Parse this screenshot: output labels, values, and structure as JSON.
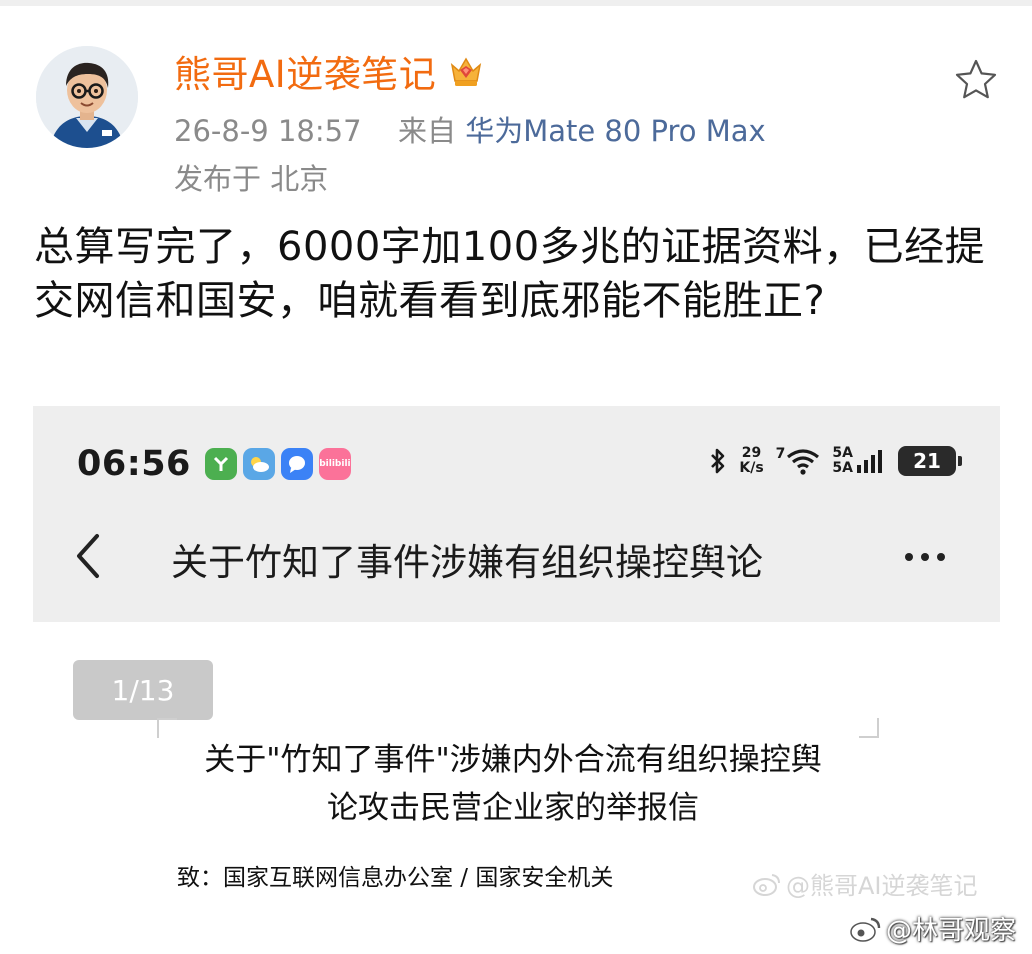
{
  "post": {
    "author_name": "熊哥AI逆袭笔记",
    "timestamp": "26-8-9 18:57",
    "source_prefix": "来自",
    "device": "华为Mate 80 Pro Max",
    "location": "发布于 北京",
    "text": "总算写完了，6000字加100多兆的证据资料，已经提交网信和国安，咱就看看到底邪能不能胜正?",
    "icons": {
      "badge": "crown-gem-icon",
      "favorite": "star-outline-icon"
    }
  },
  "screenshot": {
    "status_time": "06:56",
    "app_icons": [
      "green-app-icon",
      "weather-app-icon",
      "message-app-icon",
      "bilibili-icon"
    ],
    "bilibili_label": "bilibili",
    "network_speed_value": "29",
    "network_speed_unit": "K/s",
    "signal_label_1": "5A",
    "signal_label_2": "5A",
    "wifi_label": "7",
    "battery_level": "21",
    "nav_title": "关于竹知了事件涉嫌有组织操控舆论",
    "page_indicator": "1/13",
    "doc_title_line1": "关于\"竹知了事件\"涉嫌内外合流有组织操控舆",
    "doc_title_line2": "论攻击民营企业家的举报信",
    "doc_recipient": "致：国家互联网信息办公室 / 国家安全机关"
  },
  "watermarks": {
    "inner": "@熊哥AI逆袭笔记",
    "outer": "@林哥观察"
  }
}
